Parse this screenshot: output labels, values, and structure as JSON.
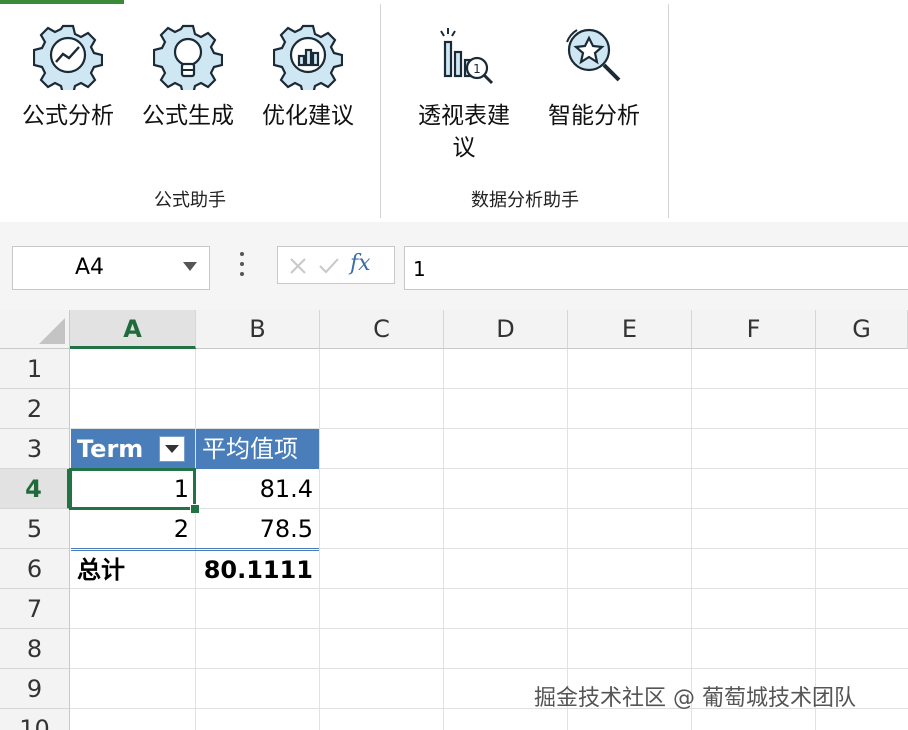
{
  "ribbon": {
    "groups": [
      {
        "label": "公式助手",
        "buttons": [
          {
            "label": "公式分析",
            "icon": "gear-chart-icon"
          },
          {
            "label": "公式生成",
            "icon": "gear-bulb-icon"
          },
          {
            "label": "优化建议",
            "icon": "gear-bars-icon"
          }
        ]
      },
      {
        "label": "数据分析助手",
        "buttons": [
          {
            "label_line1": "透视表建",
            "label_line2": "议",
            "icon": "pivot-search-icon"
          },
          {
            "label": "智能分析",
            "icon": "star-search-icon"
          }
        ]
      }
    ]
  },
  "formula_bar": {
    "name_box": "A4",
    "fx": "fx",
    "formula": "1"
  },
  "sheet": {
    "columns": [
      "A",
      "B",
      "C",
      "D",
      "E",
      "F",
      "G"
    ],
    "rows": [
      "1",
      "2",
      "3",
      "4",
      "5",
      "6",
      "7",
      "8",
      "9",
      "10"
    ],
    "selected_cell": "A4",
    "pivot": {
      "header_term": "Term",
      "header_avg": "平均值项",
      "rows": [
        {
          "term": "1",
          "avg": "81.4"
        },
        {
          "term": "2",
          "avg": "78.5"
        }
      ],
      "total_label": "总计",
      "total_value": "80.1111"
    }
  },
  "watermark": "掘金技术社区 @ 葡萄城技术团队",
  "colors": {
    "pivot_header": "#4a7ebb",
    "selection": "#217346",
    "icon_fill": "#cfe7f3",
    "icon_stroke": "#1a2a36"
  }
}
